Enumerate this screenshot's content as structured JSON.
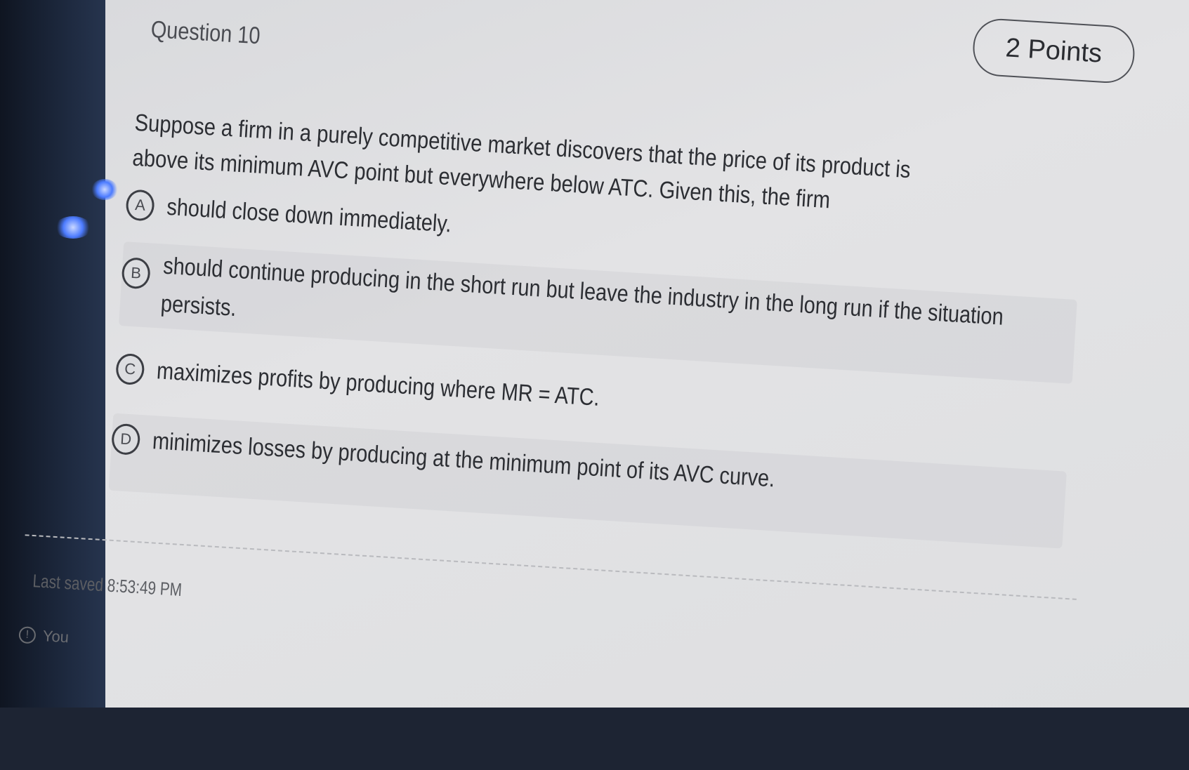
{
  "question": {
    "title": "Question 10",
    "points": "2 Points",
    "text": "Suppose a firm in a purely competitive market discovers that the price of its product is above its minimum AVC point but everywhere below ATC. Given this, the firm"
  },
  "options": [
    {
      "letter": "A",
      "text": "should close down immediately."
    },
    {
      "letter": "B",
      "text": "should continue producing in the short run but leave the industry in the long run if the situation persists."
    },
    {
      "letter": "C",
      "text": "maximizes profits by producing where MR = ATC."
    },
    {
      "letter": "D",
      "text": "minimizes losses by producing at the minimum point of its AVC curve."
    }
  ],
  "footer": {
    "last_saved": "Last saved 8:53:49 PM",
    "info_text": "You"
  },
  "icons": {
    "info": "info-icon"
  }
}
